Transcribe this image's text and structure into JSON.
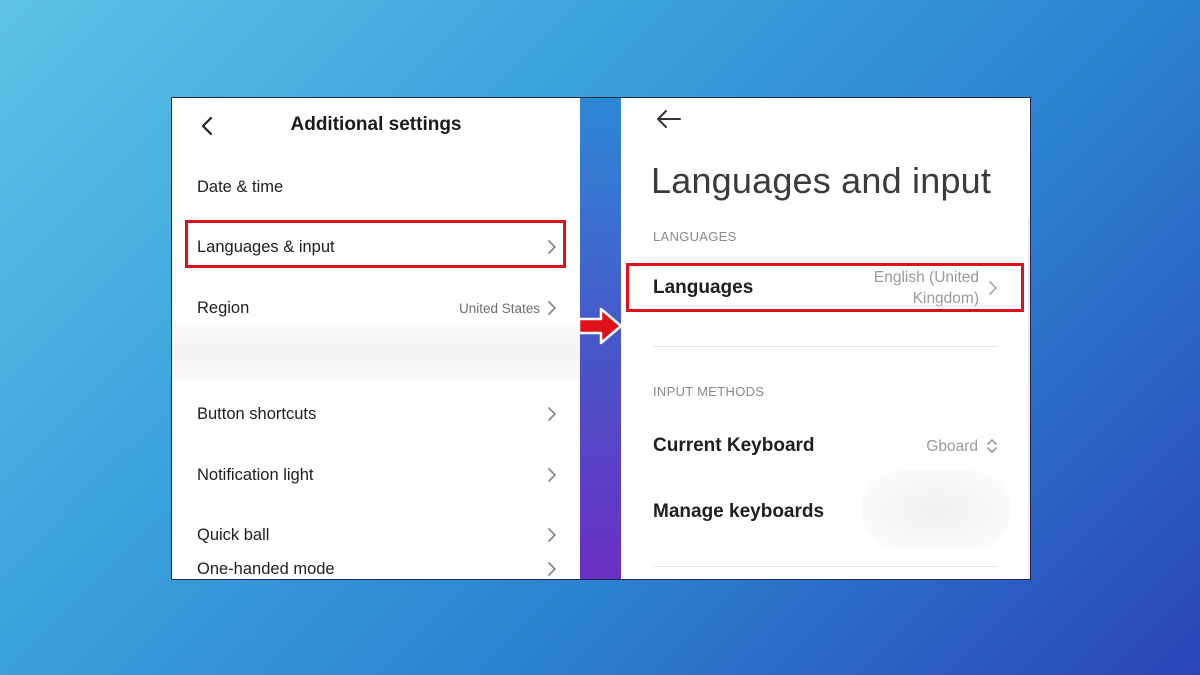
{
  "left": {
    "title": "Additional settings",
    "items": [
      {
        "label": "Date & time",
        "value": ""
      },
      {
        "label": "Languages & input",
        "value": ""
      },
      {
        "label": "Region",
        "value": "United States"
      },
      {
        "label": "Button shortcuts",
        "value": ""
      },
      {
        "label": "Notification light",
        "value": ""
      },
      {
        "label": "Quick ball",
        "value": ""
      },
      {
        "label": "One-handed mode",
        "value": ""
      }
    ]
  },
  "right": {
    "title": "Languages and input",
    "sections": [
      {
        "header": "LANGUAGES",
        "items": [
          {
            "label": "Languages",
            "value_line1": "English (United",
            "value_line2": "Kingdom)"
          }
        ]
      },
      {
        "header": "INPUT METHODS",
        "items": [
          {
            "label": "Current Keyboard",
            "value": "Gboard"
          },
          {
            "label": "Manage keyboards",
            "value": ""
          }
        ]
      }
    ]
  },
  "colors": {
    "highlight": "#e0101a",
    "arrow": "#e0101a",
    "strip_top": "#2d88d6",
    "strip_bottom": "#6a2fc2"
  },
  "icons": {
    "back": "chevron-left-icon",
    "back_right": "arrow-left-icon",
    "row_chevron": "chevron-right-icon",
    "keyboard_selector": "chevron-up-down-icon",
    "transition": "red-arrow-icon"
  }
}
